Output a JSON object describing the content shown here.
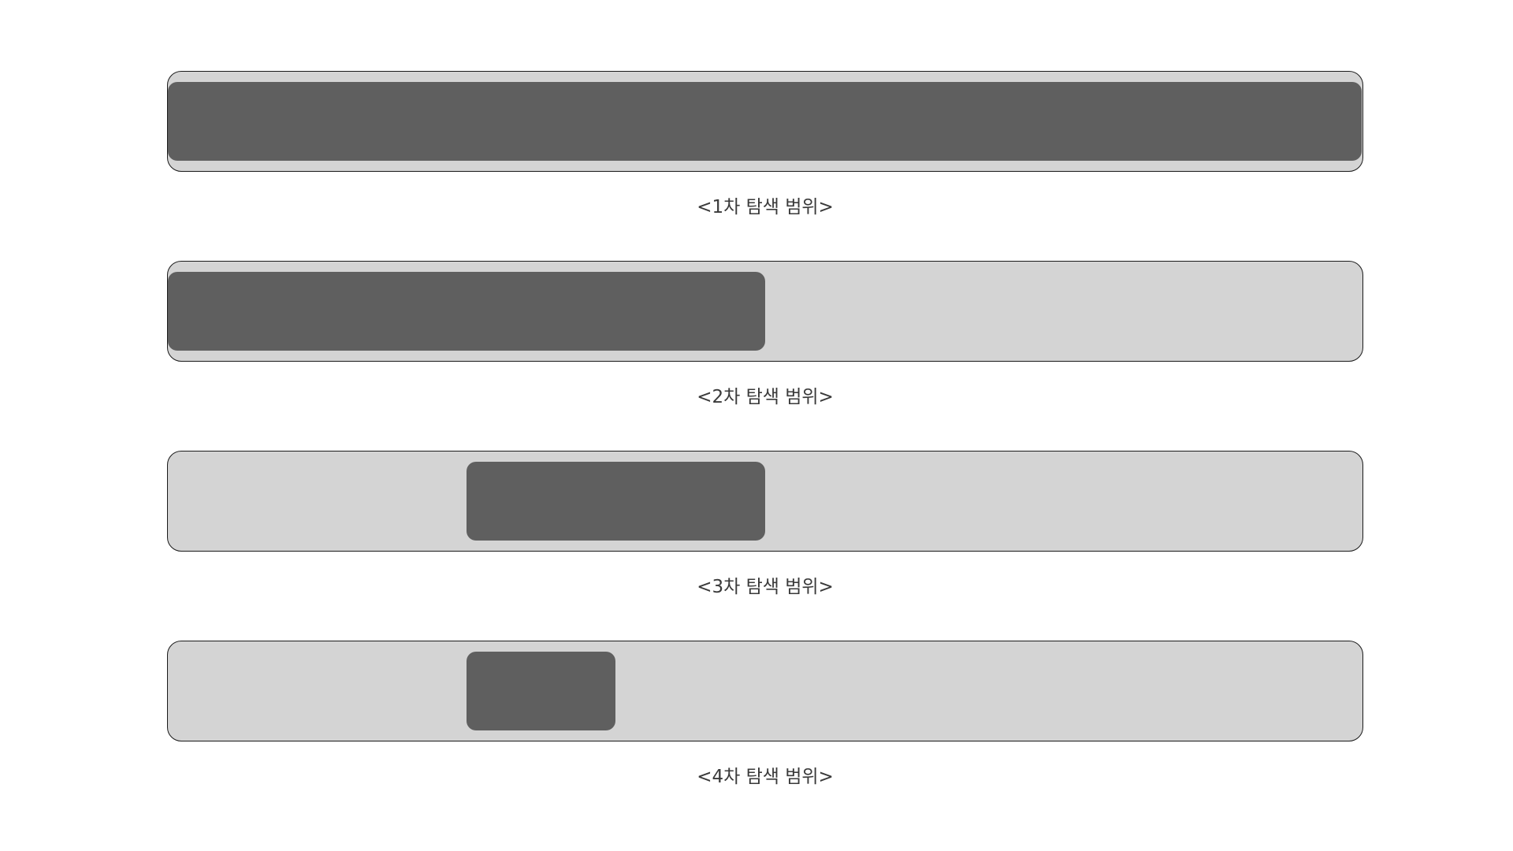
{
  "colors": {
    "track": "#d4d4d4",
    "fill": "#5f5f5f",
    "border": "#1a1a1a",
    "caption": "#3a3a3a"
  },
  "stages": [
    {
      "label": "<1차 탐색 범위>",
      "range": [
        0,
        1
      ]
    },
    {
      "label": "<2차 탐색 범위>",
      "range": [
        0,
        0.5
      ]
    },
    {
      "label": "<3차 탐색 범위>",
      "range": [
        0.25,
        0.5
      ]
    },
    {
      "label": "<4차 탐색 범위>",
      "range": [
        0.25,
        0.375
      ]
    }
  ]
}
